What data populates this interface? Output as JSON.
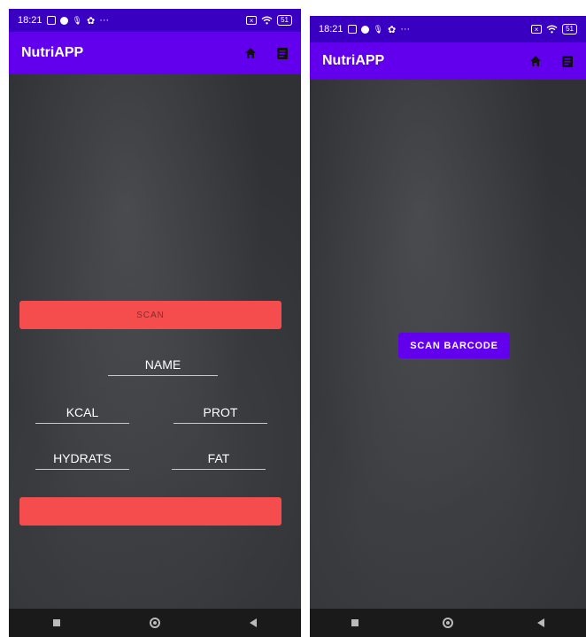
{
  "status_bar": {
    "time": "18:21",
    "dots": "···",
    "battery": "51"
  },
  "left_screen": {
    "app_title": "NutriAPP",
    "scan_button_label": "SCAN",
    "fields": {
      "name": "NAME",
      "kcal": "KCAL",
      "prot": "PROT",
      "hydrats": "HYDRATS",
      "fat": "FAT"
    },
    "submit_button_label": ""
  },
  "right_screen": {
    "app_title": "NutriAPP",
    "scan_barcode_label": "SCAN BARCODE"
  },
  "colors": {
    "status_bar": "#3a00c2",
    "app_bar": "#6200ee",
    "red_button": "#f54d4d",
    "purple_button": "#6200ee",
    "background": "#2f3134"
  },
  "icons": [
    "home-icon",
    "list-icon",
    "wifi-icon",
    "battery-icon",
    "settings-icon",
    "mic-icon"
  ]
}
